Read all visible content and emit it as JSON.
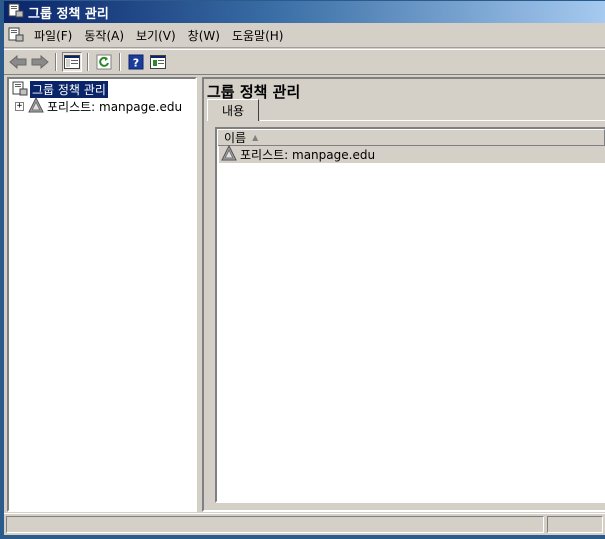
{
  "window": {
    "title": "그룹 정책 관리"
  },
  "menu": [
    "파일(F)",
    "동작(A)",
    "보기(V)",
    "창(W)",
    "도움말(H)"
  ],
  "toolbar": [
    "back-icon",
    "forward-icon",
    "show-hide-tree-icon",
    "refresh-icon",
    "help-icon",
    "properties-icon"
  ],
  "tree": {
    "root": "그룹 정책 관리",
    "forest": "포리스트: manpage.edu",
    "expander": "+"
  },
  "content": {
    "title": "그룹 정책 관리",
    "tab": "내용",
    "column_name": "이름",
    "sort": "▲",
    "rows": [
      "포리스트: manpage.edu"
    ]
  },
  "colors": {
    "titlebar": "#0a246a",
    "selection": "#0a246a",
    "face": "#d4d0c8"
  }
}
